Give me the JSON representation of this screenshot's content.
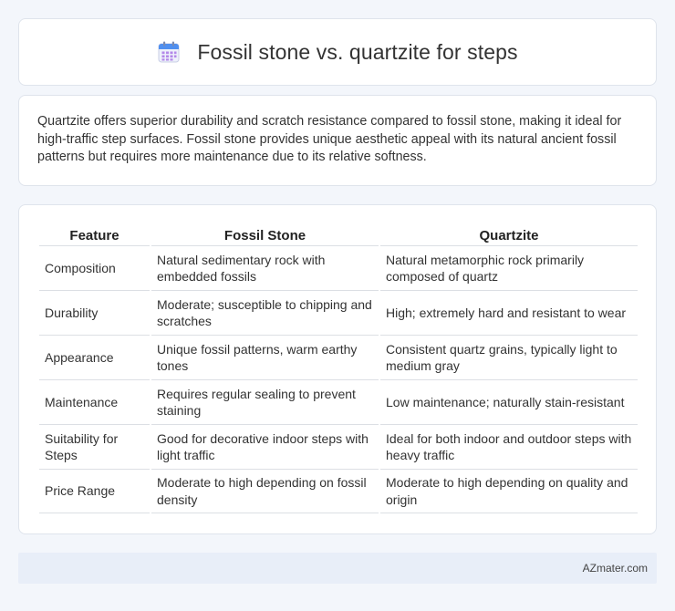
{
  "header": {
    "title": "Fossil stone vs. quartzite for steps",
    "icon": "calendar-icon"
  },
  "summary": {
    "text": "Quartzite offers superior durability and scratch resistance compared to fossil stone, making it ideal for high-traffic step surfaces. Fossil stone provides unique aesthetic appeal with its natural ancient fossil patterns but requires more maintenance due to its relative softness."
  },
  "table": {
    "headers": [
      "Feature",
      "Fossil Stone",
      "Quartzite"
    ],
    "rows": [
      [
        "Composition",
        "Natural sedimentary rock with embedded fossils",
        "Natural metamorphic rock primarily composed of quartz"
      ],
      [
        "Durability",
        "Moderate; susceptible to chipping and scratches",
        "High; extremely hard and resistant to wear"
      ],
      [
        "Appearance",
        "Unique fossil patterns, warm earthy tones",
        "Consistent quartz grains, typically light to medium gray"
      ],
      [
        "Maintenance",
        "Requires regular sealing to prevent staining",
        "Low maintenance; naturally stain-resistant"
      ],
      [
        "Suitability for Steps",
        "Good for decorative indoor steps with light traffic",
        "Ideal for both indoor and outdoor steps with heavy traffic"
      ],
      [
        "Price Range",
        "Moderate to high depending on fossil density",
        "Moderate to high depending on quality and origin"
      ]
    ]
  },
  "footer": {
    "brand": "AZmater.com"
  },
  "colors": {
    "background": "#f3f6fb",
    "card": "#ffffff",
    "icon_blue": "#4f8ff0",
    "icon_purple": "#b388e8",
    "footer_bar": "#e8eef8"
  }
}
